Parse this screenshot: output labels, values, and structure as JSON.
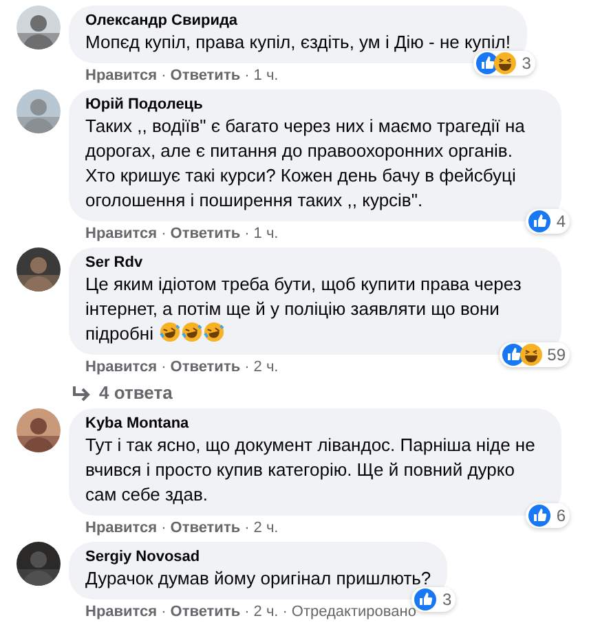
{
  "comments": [
    {
      "author": "Олександр Свирида",
      "text": "Мопєд купіл, права купіл, єздіть, ум і Дію - не купіл!",
      "reactions": {
        "icons": [
          {
            "kind": "like"
          },
          {
            "kind": "haha"
          }
        ],
        "count": "3"
      },
      "actions": {
        "like": "Нравится",
        "sep1": "·",
        "reply": "Ответить",
        "sep2": "·",
        "time": "1 ч."
      }
    },
    {
      "author": "Юрій Подолець",
      "text": "Таких ,, водіїв\" є багато через них і маємо трагедії на дорогах, але є питання до правоохоронних органів. Хто кришує такі курси? Кожен день бачу в фейсбуці оголошення і поширення таких ,, курсів\".",
      "reactions": {
        "icons": [
          {
            "kind": "like"
          }
        ],
        "count": "4"
      },
      "actions": {
        "like": "Нравится",
        "sep1": "·",
        "reply": "Ответить",
        "sep2": "·",
        "time": "1 ч."
      }
    },
    {
      "author": "Ser Rdv",
      "text": "Це яким ідіотом треба бути, щоб купити права через інтернет, а потім ще й у поліцію заявляти що вони підробні",
      "emoji": [
        {
          "kind": "rofl"
        },
        {
          "kind": "rofl"
        },
        {
          "kind": "rofl"
        }
      ],
      "reactions": {
        "icons": [
          {
            "kind": "like"
          },
          {
            "kind": "haha"
          }
        ],
        "count": "59"
      },
      "actions": {
        "like": "Нравится",
        "sep1": "·",
        "reply": "Ответить",
        "sep2": "·",
        "time": "2 ч."
      },
      "replies": "4 ответа"
    },
    {
      "author": "Kyba Montana",
      "text": "Тут і так ясно, що документ лівандос. Парніша ніде не вчився і просто купив категорію. Ще й повний дурко сам себе здав.",
      "reactions": {
        "icons": [
          {
            "kind": "like"
          }
        ],
        "count": "6"
      },
      "actions": {
        "like": "Нравится",
        "sep1": "·",
        "reply": "Ответить",
        "sep2": "·",
        "time": "2 ч."
      }
    },
    {
      "author": "Sergiy Novosad",
      "text": "Дурачок думав йому оригінал пришлють?",
      "reactions": {
        "icons": [
          {
            "kind": "like"
          }
        ],
        "count": "3"
      },
      "actions": {
        "like": "Нравится",
        "sep1": "·",
        "reply": "Ответить",
        "sep2": "·",
        "time": "2 ч.",
        "sep3": "·",
        "edited": "Отредактировано"
      }
    }
  ]
}
